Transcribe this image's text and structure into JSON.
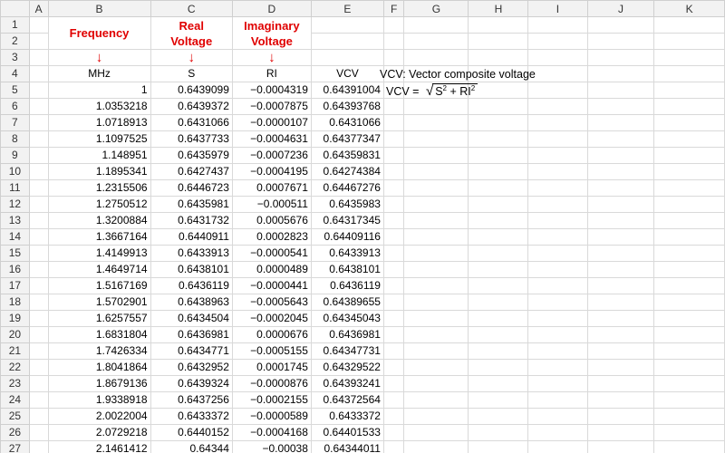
{
  "columns": [
    "A",
    "B",
    "C",
    "D",
    "E",
    "F",
    "G",
    "H",
    "I",
    "J",
    "K"
  ],
  "headers": {
    "frequency": "Frequency",
    "real_voltage": "Real Voltage",
    "imaginary_voltage": "Imaginary Voltage",
    "arrow": "↓"
  },
  "units": {
    "b": "MHz",
    "c": "S",
    "d": "RI",
    "e": "VCV"
  },
  "note": {
    "title": "VCV: Vector composite voltage",
    "formula_left": "VCV =",
    "formula_s": "S",
    "formula_sup": "2",
    "formula_plus": " + RI",
    "formula_sup2": "2",
    "sqrt_symbol": "√"
  },
  "rows": [
    {
      "n": "5",
      "b": "1",
      "c": "0.6439099",
      "d": "−0.0004319",
      "e": "0.64391004"
    },
    {
      "n": "6",
      "b": "1.0353218",
      "c": "0.6439372",
      "d": "−0.0007875",
      "e": "0.64393768"
    },
    {
      "n": "7",
      "b": "1.0718913",
      "c": "0.6431066",
      "d": "−0.0000107",
      "e": "0.6431066"
    },
    {
      "n": "8",
      "b": "1.1097525",
      "c": "0.6437733",
      "d": "−0.0004631",
      "e": "0.64377347"
    },
    {
      "n": "9",
      "b": "1.148951",
      "c": "0.6435979",
      "d": "−0.0007236",
      "e": "0.64359831"
    },
    {
      "n": "10",
      "b": "1.1895341",
      "c": "0.6427437",
      "d": "−0.0004195",
      "e": "0.64274384"
    },
    {
      "n": "11",
      "b": "1.2315506",
      "c": "0.6446723",
      "d": "0.0007671",
      "e": "0.64467276"
    },
    {
      "n": "12",
      "b": "1.2750512",
      "c": "0.6435981",
      "d": "−0.000511",
      "e": "0.6435983"
    },
    {
      "n": "13",
      "b": "1.3200884",
      "c": "0.6431732",
      "d": "0.0005676",
      "e": "0.64317345"
    },
    {
      "n": "14",
      "b": "1.3667164",
      "c": "0.6440911",
      "d": "0.0002823",
      "e": "0.64409116"
    },
    {
      "n": "15",
      "b": "1.4149913",
      "c": "0.6433913",
      "d": "−0.0000541",
      "e": "0.6433913"
    },
    {
      "n": "16",
      "b": "1.4649714",
      "c": "0.6438101",
      "d": "0.0000489",
      "e": "0.6438101"
    },
    {
      "n": "17",
      "b": "1.5167169",
      "c": "0.6436119",
      "d": "−0.0000441",
      "e": "0.6436119"
    },
    {
      "n": "18",
      "b": "1.5702901",
      "c": "0.6438963",
      "d": "−0.0005643",
      "e": "0.64389655"
    },
    {
      "n": "19",
      "b": "1.6257557",
      "c": "0.6434504",
      "d": "−0.0002045",
      "e": "0.64345043"
    },
    {
      "n": "20",
      "b": "1.6831804",
      "c": "0.6436981",
      "d": "0.0000676",
      "e": "0.6436981"
    },
    {
      "n": "21",
      "b": "1.7426334",
      "c": "0.6434771",
      "d": "−0.0005155",
      "e": "0.64347731"
    },
    {
      "n": "22",
      "b": "1.8041864",
      "c": "0.6432952",
      "d": "0.0001745",
      "e": "0.64329522"
    },
    {
      "n": "23",
      "b": "1.8679136",
      "c": "0.6439324",
      "d": "−0.0000876",
      "e": "0.64393241"
    },
    {
      "n": "24",
      "b": "1.9338918",
      "c": "0.6437256",
      "d": "−0.0002155",
      "e": "0.64372564"
    },
    {
      "n": "25",
      "b": "2.0022004",
      "c": "0.6433372",
      "d": "−0.0000589",
      "e": "0.6433372"
    },
    {
      "n": "26",
      "b": "2.0729218",
      "c": "0.6440152",
      "d": "−0.0004168",
      "e": "0.64401533"
    },
    {
      "n": "27",
      "b": "2.1461412",
      "c": "0.64344",
      "d": "−0.00038",
      "e": "0.64344011"
    }
  ]
}
